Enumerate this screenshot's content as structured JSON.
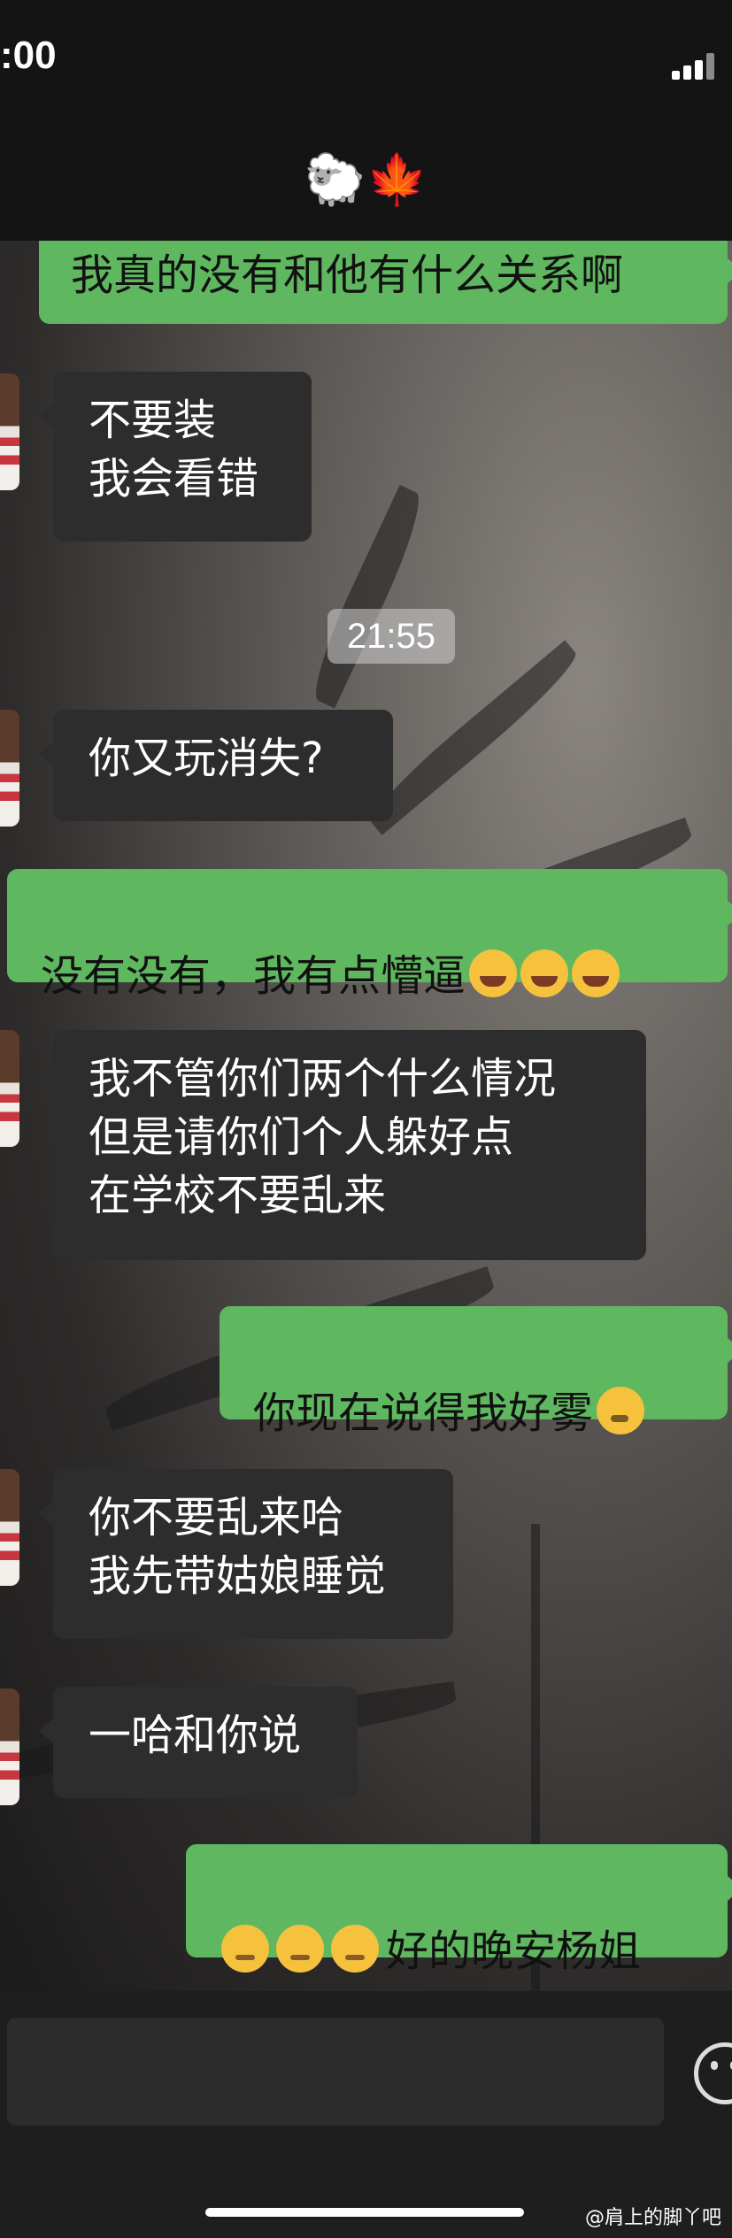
{
  "status_bar": {
    "time": ":00"
  },
  "header": {
    "title": "🐑🍁"
  },
  "messages": [
    {
      "side": "out",
      "text": "我真的没有和他有什么关系啊"
    },
    {
      "side": "in",
      "text": "不要装\n我会看错"
    },
    {
      "side": "in",
      "text": "你又玩消失?"
    },
    {
      "side": "out",
      "text": "没有没有，我有点懵逼"
    },
    {
      "side": "in",
      "text": "我不管你们两个什么情况\n但是请你们个人躲好点\n在学校不要乱来"
    },
    {
      "side": "out",
      "text": "你现在说得我好雾"
    },
    {
      "side": "in",
      "text": "你不要乱来哈\n我先带姑娘睡觉"
    },
    {
      "side": "in",
      "text": "一哈和你说"
    },
    {
      "side": "out",
      "text": "好的晚安杨姐"
    }
  ],
  "time_divider": "21:55",
  "emojis": {
    "cry": "crying-laughing-icon",
    "sick": "sneezing-face-icon",
    "sad": "pensive-face-icon"
  },
  "watermark": "@肩上的脚丫吧",
  "colors": {
    "out_bubble": "#5fb860",
    "in_bubble": "#2d2d2d"
  }
}
